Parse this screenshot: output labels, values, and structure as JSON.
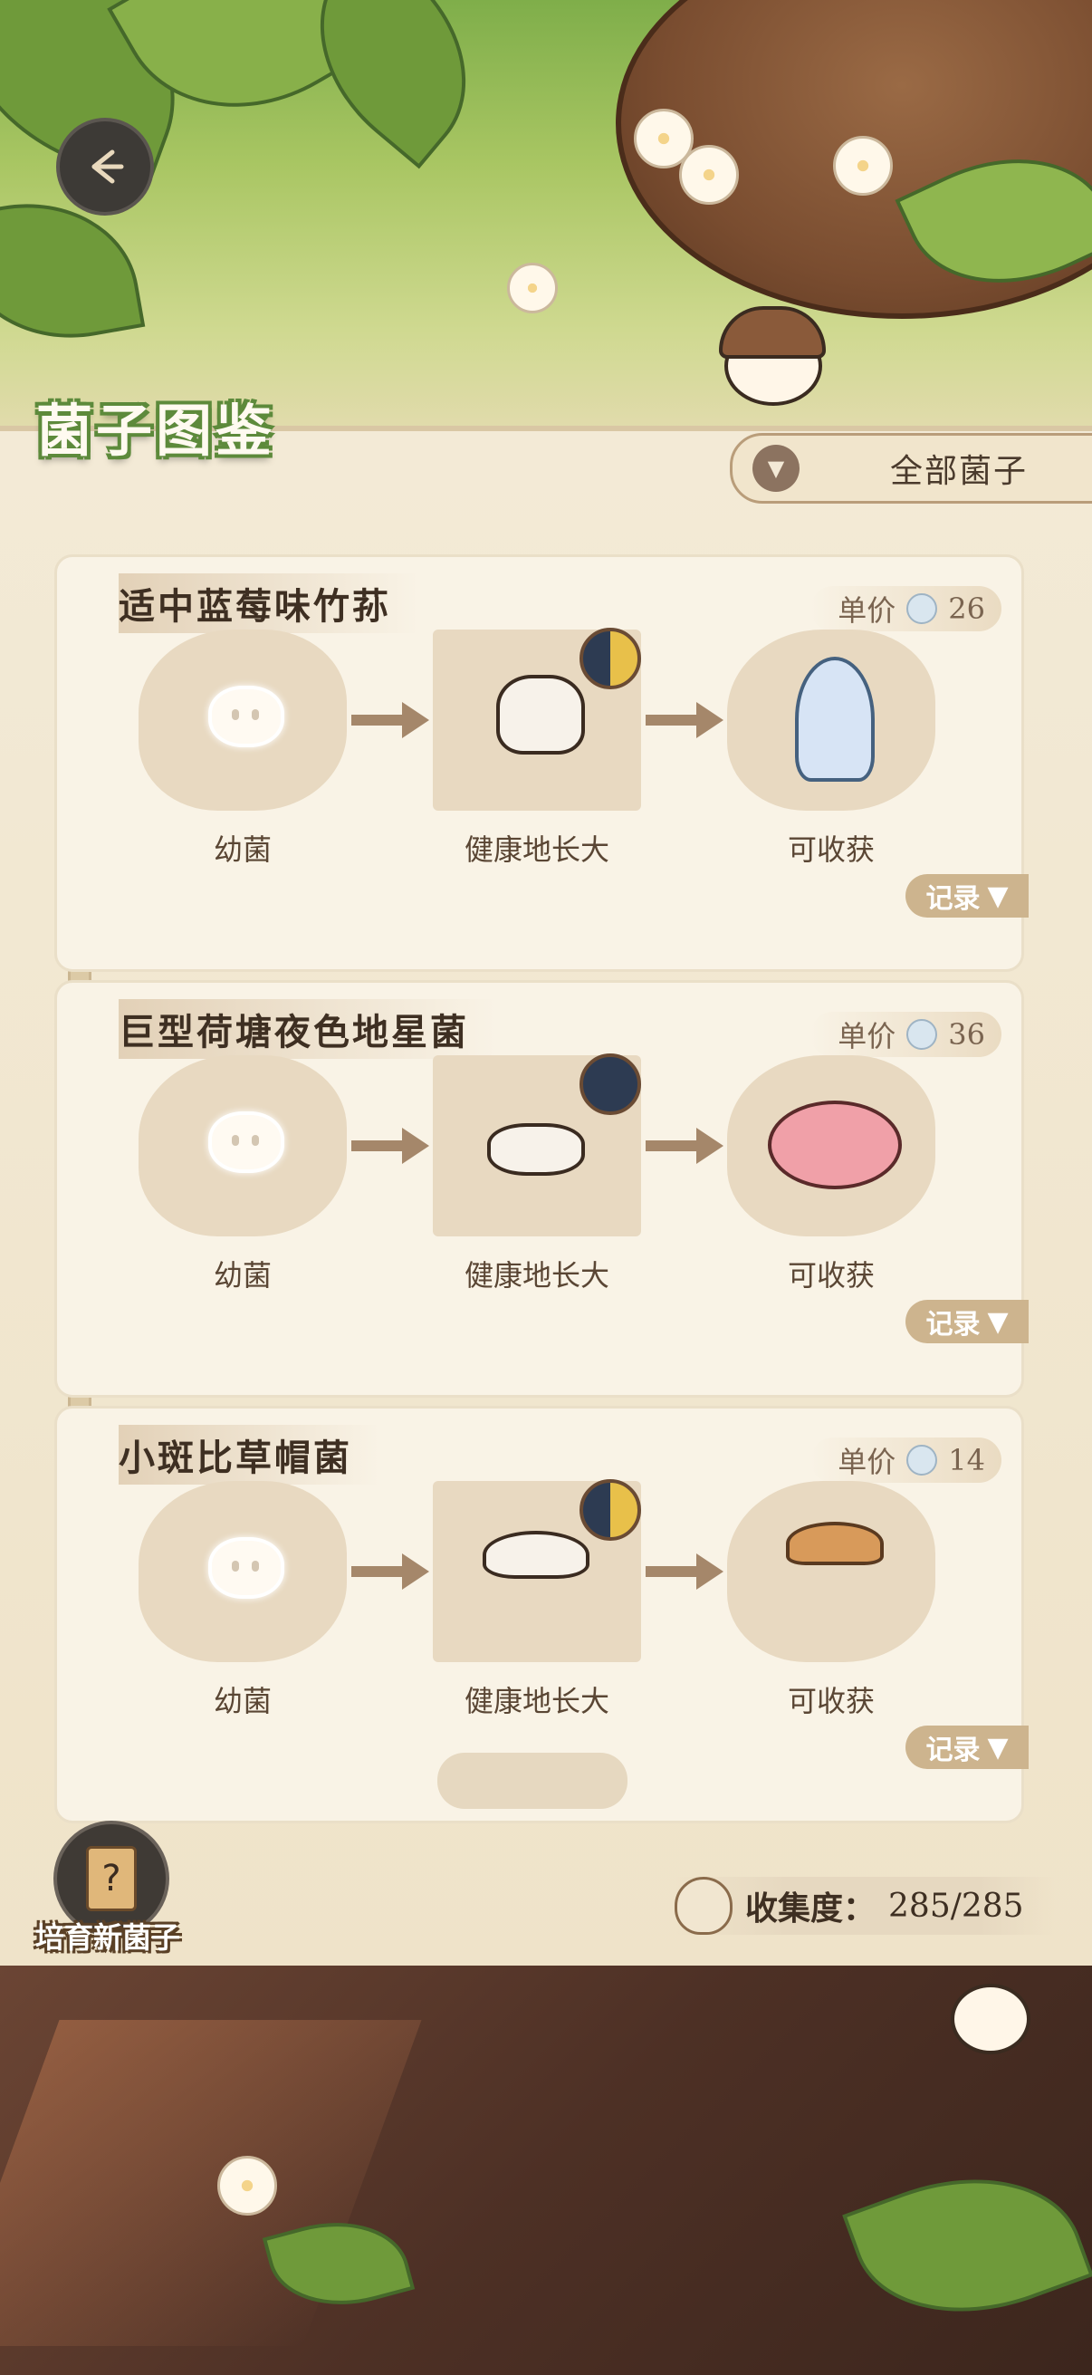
{
  "header": {
    "title": "菌子图鉴"
  },
  "filter": {
    "label": "全部菌子"
  },
  "labels": {
    "price": "单价",
    "record": "记录"
  },
  "stages": {
    "seedling": "幼菌",
    "growing": "健康地长大",
    "harvest": "可收获"
  },
  "cards": [
    {
      "name": "适中蓝莓味竹荪",
      "price": "26"
    },
    {
      "name": "巨型荷塘夜色地星菌",
      "price": "36"
    },
    {
      "name": "小斑比草帽菌",
      "price": "14"
    }
  ],
  "footer": {
    "cultivate_label": "培育新菌子",
    "collection_label": "收集度：",
    "collection_value": "285/285"
  },
  "icons": {
    "back": "back-arrow-icon",
    "filter": "dropdown-triangle-icon",
    "coin": "coin-icon",
    "clock": "day-night-clock-icon",
    "collection": "collection-bag-icon"
  }
}
